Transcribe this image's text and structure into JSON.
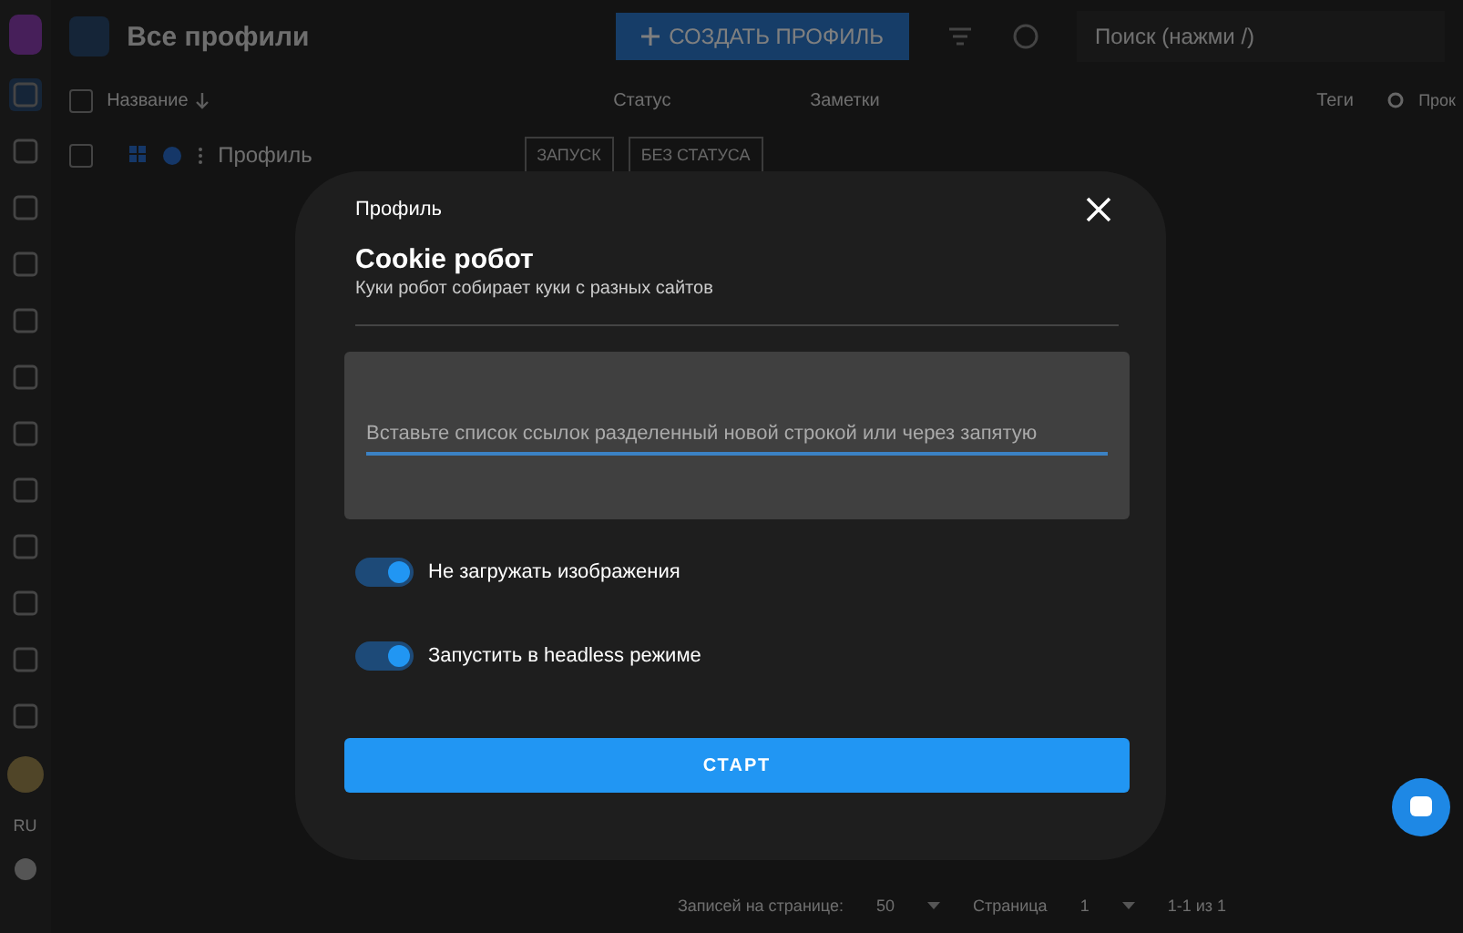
{
  "header": {
    "title": "Все профили",
    "create_button": "СОЗДАТЬ ПРОФИЛЬ",
    "search": {
      "placeholder": "Поиск (нажми /)"
    }
  },
  "sidebar": {
    "language": "RU"
  },
  "table": {
    "select_all": {
      "checked": false
    },
    "columns": [
      "Название",
      "Статус",
      "Заметки",
      "Теги",
      "Прок"
    ],
    "rows": [
      {
        "checked": false,
        "name": "Профиль",
        "launch": "ЗАПУСК",
        "status": "БЕЗ СТАТУСА"
      }
    ]
  },
  "pagination": {
    "per_page_label": "Записей на странице:",
    "per_page": "50",
    "page_label": "Страница",
    "page": "1",
    "range": "1-1 из 1"
  },
  "dialog": {
    "header": "Профиль",
    "title": "Cookie робот",
    "subtitle": "Куки робот собирает куки с разных сайтов",
    "links_field": {
      "placeholder": "Вставьте список ссылок разделенный новой строкой или через запятую"
    },
    "options": [
      {
        "label": "Не загружать изображения",
        "on": true
      },
      {
        "label": "Запустить в headless режиме",
        "on": true
      }
    ],
    "start_button": "СТАРТ"
  }
}
